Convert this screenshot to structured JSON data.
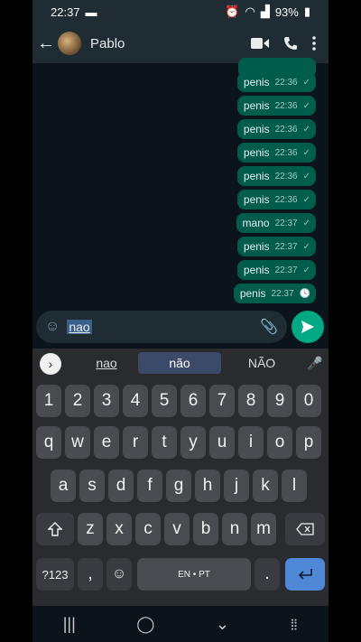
{
  "status": {
    "time": "22:37",
    "battery": "93%"
  },
  "header": {
    "contact_name": "Pablo"
  },
  "messages": [
    {
      "text": "penis",
      "time": "22:36",
      "status": "✓"
    },
    {
      "text": "penis",
      "time": "22:36",
      "status": "✓"
    },
    {
      "text": "penis",
      "time": "22:36",
      "status": "✓"
    },
    {
      "text": "penis",
      "time": "22:36",
      "status": "✓"
    },
    {
      "text": "penis",
      "time": "22:36",
      "status": "✓"
    },
    {
      "text": "penis",
      "time": "22:36",
      "status": "✓"
    },
    {
      "text": "mano",
      "time": "22:37",
      "status": "✓"
    },
    {
      "text": "penis",
      "time": "22:37",
      "status": "✓"
    },
    {
      "text": "penis",
      "time": "22:37",
      "status": "✓"
    },
    {
      "text": "penis",
      "time": "22:37",
      "status": "🕓"
    }
  ],
  "composer": {
    "text": "nao"
  },
  "suggestions": [
    "nao",
    "não",
    "NÃO"
  ],
  "keyboard": {
    "row1": [
      "1",
      "2",
      "3",
      "4",
      "5",
      "6",
      "7",
      "8",
      "9",
      "0"
    ],
    "row2": [
      "q",
      "w",
      "e",
      "r",
      "t",
      "y",
      "u",
      "i",
      "o",
      "p"
    ],
    "row3": [
      "a",
      "s",
      "d",
      "f",
      "g",
      "h",
      "j",
      "k",
      "l"
    ],
    "row4": [
      "z",
      "x",
      "c",
      "v",
      "b",
      "n",
      "m"
    ],
    "symbols": "?123",
    "comma": ",",
    "space": "EN • PT",
    "period": "."
  },
  "colors": {
    "bubble": "#005c4b",
    "send": "#00a884",
    "enter": "#4f88d6"
  }
}
